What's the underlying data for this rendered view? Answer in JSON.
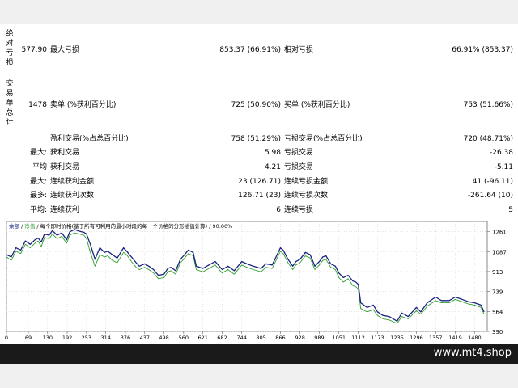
{
  "report": {
    "abs_drawdown": {
      "side_label": "绝对亏损",
      "value": "577.90",
      "max_label": "最大亏损",
      "max_value": "853.37 (66.91%)",
      "rel_label": "相对亏损",
      "rel_value": "66.91% (853.37)"
    },
    "trades": {
      "side_label": "交易单总计",
      "value": "1478",
      "sell_label": "卖单 (%获利百分比)",
      "sell_value": "725 (50.90%)",
      "buy_label": "买单 (%获利百分比)",
      "buy_value": "753 (51.66%)"
    },
    "rows": [
      {
        "prefix": "",
        "l_label": "盈利交易(%占总百分比)",
        "l_value": "758 (51.29%)",
        "r_label": "亏损交易(%占总百分比)",
        "r_value": "720 (48.71%)"
      },
      {
        "prefix": "最大:",
        "l_label": "获利交易",
        "l_value": "5.98",
        "r_label": "亏损交易",
        "r_value": "-26.38"
      },
      {
        "prefix": "平均",
        "l_label": "获利交易",
        "l_value": "4.21",
        "r_label": "亏损交易",
        "r_value": "-5.11"
      },
      {
        "prefix": "最大:",
        "l_label": "连续获利金额",
        "l_value": "23 (126.71)",
        "r_label": "连续亏损金额",
        "r_value": "41 (-96.11)"
      },
      {
        "prefix": "最多:",
        "l_label": "连续获利次数",
        "l_value": "126.71 (23)",
        "r_label": "连续亏损次数",
        "r_value": "-261.64 (10)"
      },
      {
        "prefix": "平均:",
        "l_label": "连续获利",
        "l_value": "6",
        "r_label": "连续亏损",
        "r_value": "5"
      }
    ]
  },
  "chart": {
    "legend_balance": "余额",
    "legend_sep1": " / ",
    "legend_equity": "净值",
    "legend_rest": " / 每个即时价格(基于所有可利用的最小时段的每一个价格的分形插值计算) / 90.00%",
    "colors": {
      "balance": "#1a237e",
      "equity": "#2e9e2e",
      "grid": "#d6d6d6",
      "text": "#000000"
    }
  },
  "chart_data": {
    "type": "line",
    "ylim": [
      390,
      1350
    ],
    "xlim": [
      0,
      1520
    ],
    "y_ticks": [
      1261,
      1087,
      913,
      739,
      564,
      390
    ],
    "x_ticks": [
      0,
      69,
      130,
      192,
      253,
      314,
      376,
      437,
      498,
      560,
      621,
      682,
      744,
      805,
      866,
      928,
      989,
      1051,
      1112,
      1173,
      1235,
      1296,
      1357,
      1419,
      1480
    ],
    "grid": true,
    "series": [
      {
        "name": "余额",
        "x": [
          0,
          15,
          30,
          45,
          60,
          75,
          90,
          100,
          110,
          120,
          135,
          145,
          160,
          175,
          190,
          200,
          215,
          230,
          245,
          253,
          265,
          280,
          295,
          310,
          320,
          335,
          350,
          370,
          380,
          395,
          410,
          420,
          437,
          450,
          465,
          480,
          498,
          510,
          520,
          535,
          550,
          560,
          575,
          590,
          600,
          621,
          640,
          660,
          682,
          700,
          720,
          744,
          760,
          780,
          805,
          820,
          840,
          866,
          875,
          890,
          905,
          915,
          928,
          945,
          960,
          975,
          989,
          1000,
          1010,
          1025,
          1040,
          1051,
          1065,
          1080,
          1095,
          1105,
          1112,
          1120,
          1140,
          1160,
          1173,
          1190,
          1210,
          1235,
          1250,
          1270,
          1296,
          1310,
          1330,
          1357,
          1375,
          1400,
          1419,
          1440,
          1460,
          1480,
          1500,
          1510
        ],
        "values": [
          1060,
          1040,
          1120,
          1100,
          1180,
          1150,
          1190,
          1205,
          1170,
          1240,
          1230,
          1270,
          1230,
          1250,
          1190,
          1260,
          1280,
          1265,
          1255,
          1240,
          1150,
          1020,
          1120,
          1080,
          1090,
          1060,
          1030,
          1120,
          1090,
          1040,
          990,
          960,
          980,
          960,
          930,
          880,
          890,
          940,
          950,
          920,
          1020,
          1050,
          1100,
          1080,
          960,
          940,
          970,
          1000,
          930,
          960,
          920,
          1000,
          980,
          960,
          940,
          980,
          970,
          1120,
          1100,
          1020,
          960,
          1000,
          1020,
          1080,
          1060,
          960,
          1000,
          1040,
          1050,
          980,
          960,
          900,
          860,
          880,
          830,
          820,
          800,
          640,
          600,
          620,
          560,
          530,
          520,
          480,
          550,
          520,
          600,
          560,
          640,
          690,
          660,
          660,
          690,
          670,
          650,
          640,
          620,
          560
        ]
      },
      {
        "name": "净值",
        "x": [
          0,
          15,
          30,
          45,
          60,
          75,
          90,
          100,
          110,
          120,
          135,
          145,
          160,
          175,
          190,
          200,
          215,
          230,
          245,
          253,
          265,
          280,
          295,
          310,
          320,
          335,
          350,
          370,
          380,
          395,
          410,
          420,
          437,
          450,
          465,
          480,
          498,
          510,
          520,
          535,
          550,
          560,
          575,
          590,
          600,
          621,
          640,
          660,
          682,
          700,
          720,
          744,
          760,
          780,
          805,
          820,
          840,
          866,
          875,
          890,
          905,
          915,
          928,
          945,
          960,
          975,
          989,
          1000,
          1010,
          1025,
          1040,
          1051,
          1065,
          1080,
          1095,
          1105,
          1112,
          1120,
          1140,
          1160,
          1173,
          1190,
          1210,
          1235,
          1250,
          1270,
          1296,
          1310,
          1330,
          1357,
          1375,
          1400,
          1419,
          1440,
          1460,
          1480,
          1500,
          1510
        ],
        "values": [
          1040,
          1010,
          1090,
          1070,
          1150,
          1120,
          1160,
          1180,
          1130,
          1210,
          1200,
          1240,
          1200,
          1220,
          1160,
          1230,
          1250,
          1240,
          1230,
          1200,
          1080,
          960,
          1060,
          1040,
          1050,
          1010,
          990,
          1080,
          1060,
          1000,
          950,
          930,
          950,
          930,
          900,
          850,
          860,
          910,
          920,
          890,
          990,
          1020,
          1070,
          1050,
          930,
          910,
          940,
          970,
          900,
          930,
          890,
          970,
          950,
          930,
          910,
          950,
          940,
          1090,
          1070,
          990,
          930,
          970,
          990,
          1050,
          1030,
          930,
          970,
          1010,
          1020,
          950,
          930,
          860,
          820,
          850,
          790,
          780,
          760,
          590,
          560,
          580,
          530,
          500,
          490,
          460,
          520,
          500,
          570,
          540,
          610,
          660,
          640,
          640,
          670,
          650,
          630,
          620,
          600,
          540
        ]
      }
    ]
  },
  "footer": {
    "site": "www.mt4.shop"
  }
}
